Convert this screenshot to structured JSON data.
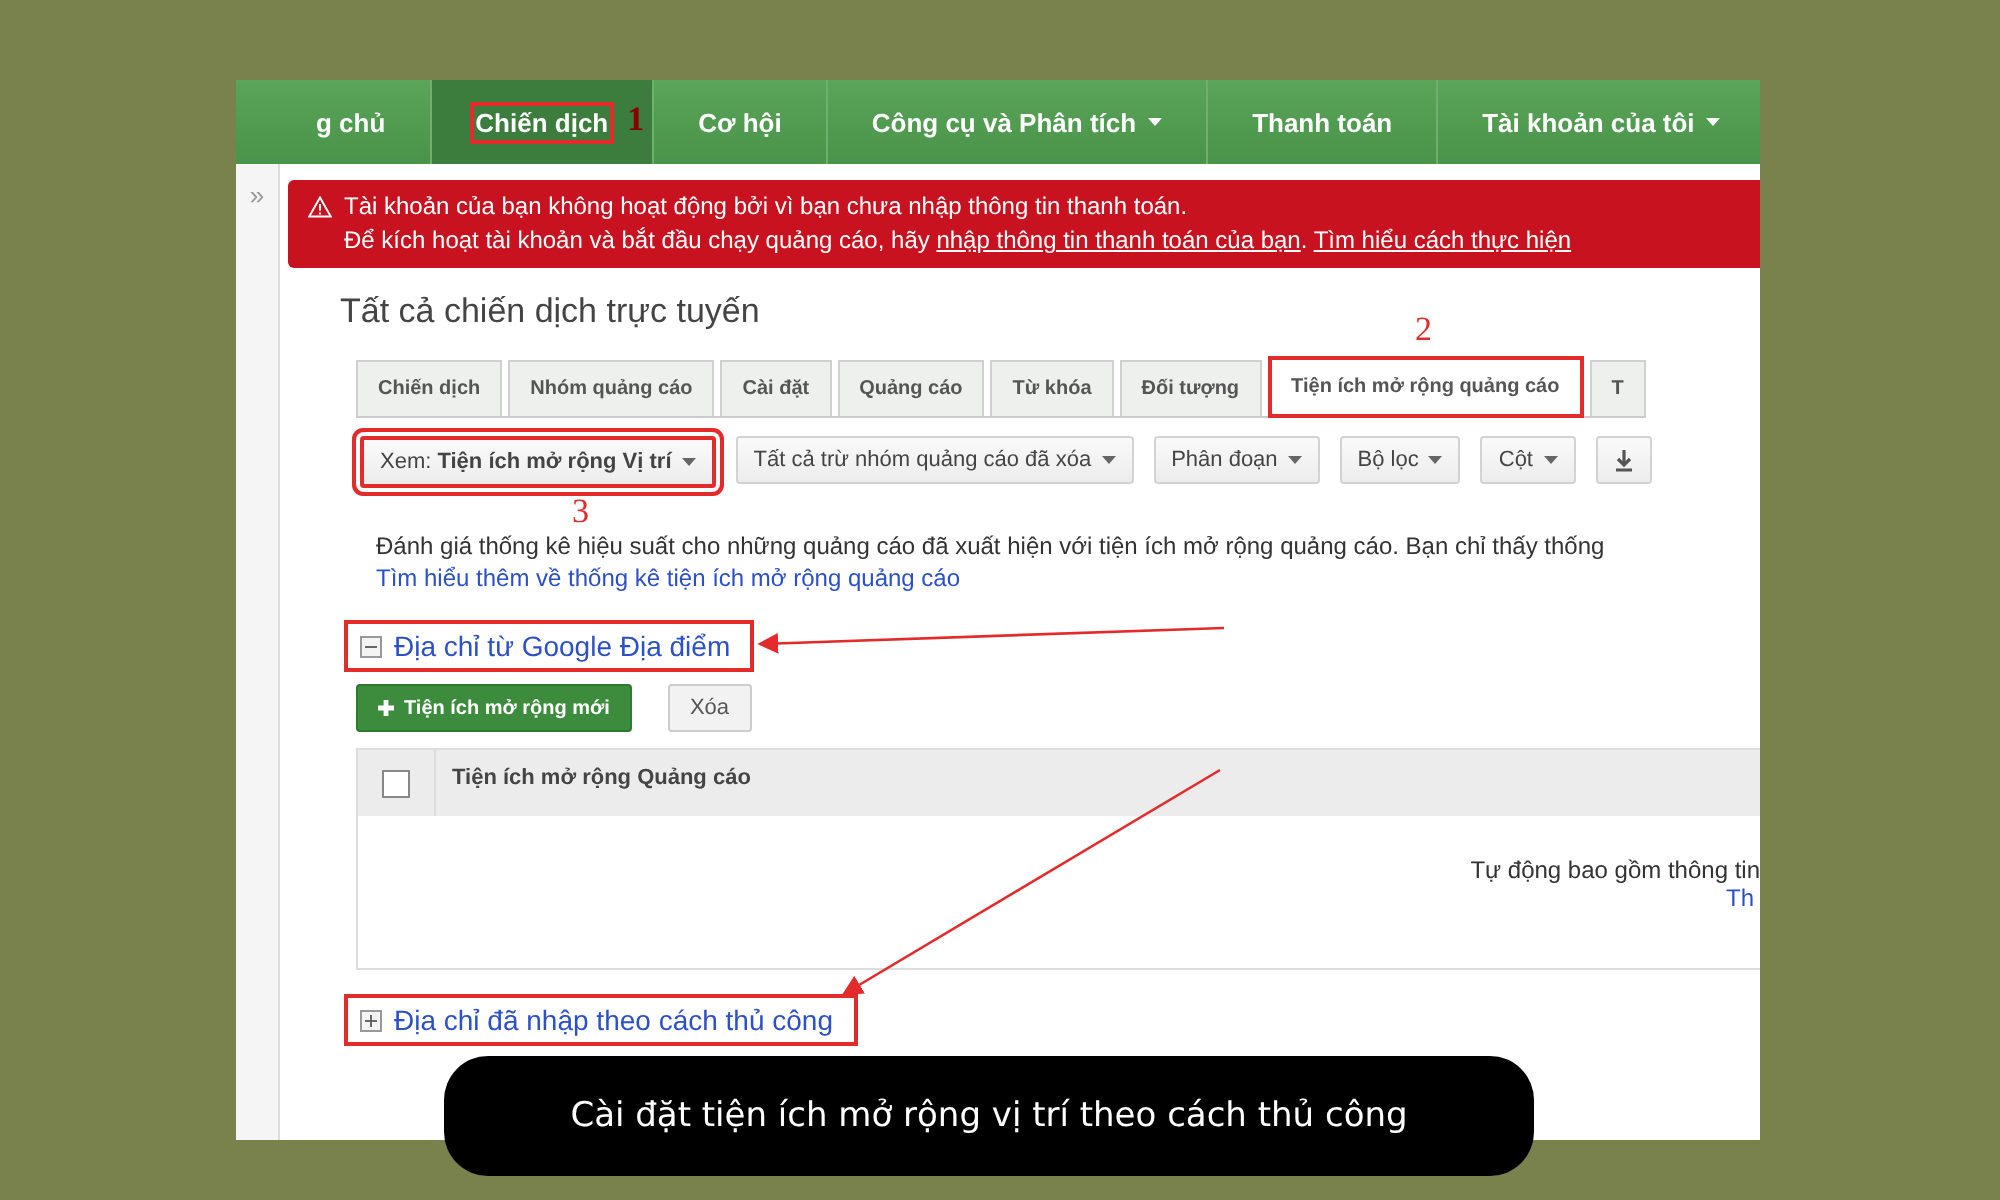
{
  "nav": {
    "items": [
      {
        "label": "g chủ",
        "selected": false,
        "dropdown": false,
        "annotated": false
      },
      {
        "label": "Chiến dịch",
        "selected": true,
        "dropdown": false,
        "annotated": true,
        "step": "1"
      },
      {
        "label": "Cơ hội",
        "selected": false,
        "dropdown": false,
        "annotated": false
      },
      {
        "label": "Công cụ và Phân tích",
        "selected": false,
        "dropdown": true,
        "annotated": false
      },
      {
        "label": "Thanh toán",
        "selected": false,
        "dropdown": false,
        "annotated": false
      },
      {
        "label": "Tài khoản của tôi",
        "selected": false,
        "dropdown": true,
        "annotated": false
      }
    ]
  },
  "sidebar_toggle": "»",
  "alert": {
    "line_1": "Tài khoản của bạn không hoạt động bởi vì bạn chưa nhập thông tin thanh toán.",
    "line_2": [
      {
        "kind": "text",
        "text": "Để kích hoạt tài khoản và bắt đầu chạy quảng cáo, hãy "
      },
      {
        "kind": "link",
        "text": "nhập thông tin thanh toán của bạn",
        "after": ". "
      },
      {
        "kind": "link",
        "text": "Tìm hiểu cách thực hiện"
      }
    ]
  },
  "page_title": "Tất cả chiến dịch trực tuyến",
  "tabs": [
    {
      "label": "Chiến dịch",
      "selected": false,
      "annotated": false
    },
    {
      "label": "Nhóm quảng cáo",
      "selected": false,
      "annotated": false
    },
    {
      "label": "Cài đặt",
      "selected": false,
      "annotated": false
    },
    {
      "label": "Quảng cáo",
      "selected": false,
      "annotated": false
    },
    {
      "label": "Từ khóa",
      "selected": false,
      "annotated": false
    },
    {
      "label": "Đối tượng",
      "selected": false,
      "annotated": false
    },
    {
      "label": "Tiện ích mở rộng quảng cáo",
      "selected": true,
      "annotated": true,
      "step": "2"
    },
    {
      "label": "T",
      "selected": false,
      "annotated": false
    }
  ],
  "toolbar": [
    {
      "kind": "dropdown",
      "label": "Xem: **Tiện ích mở rộng Vị trí**",
      "annotated": true,
      "step": "3"
    },
    {
      "kind": "dropdown",
      "label": "Tất cả trừ nhóm quảng cáo đã xóa",
      "annotated": false
    },
    {
      "kind": "dropdown",
      "label": "Phân đoạn",
      "annotated": false
    },
    {
      "kind": "dropdown",
      "label": "Bộ lọc",
      "annotated": false
    },
    {
      "kind": "dropdown",
      "label": "Cột",
      "annotated": false
    },
    {
      "kind": "download",
      "annotated": false
    }
  ],
  "description": "Đánh giá thống kê hiệu suất cho những quảng cáo đã xuất hiện với tiện ích mở rộng quảng cáo. Bạn chỉ thấy thống",
  "learn_more_link": "Tìm hiểu thêm về thống kê tiện ích mở rộng quảng cáo",
  "sections": [
    {
      "title": "Địa chỉ từ Google Địa điểm",
      "expanded": true,
      "annotated": true,
      "buttons": [
        {
          "label": "Tiện ích mở rộng mới",
          "kind": "primary"
        },
        {
          "label": "Xóa",
          "kind": "secondary"
        }
      ],
      "table": {
        "columns": [
          "Tiện ích mở rộng Quảng cáo"
        ],
        "header_checked": false,
        "empty_text": "Tự động bao gồm thông tin",
        "empty_link": "Th"
      }
    },
    {
      "title": "Địa chỉ đã nhập theo cách thủ công",
      "expanded": false,
      "annotated": true
    }
  ],
  "caption": "Cài đặt tiện ích mở rộng vị trí theo cách thủ công"
}
